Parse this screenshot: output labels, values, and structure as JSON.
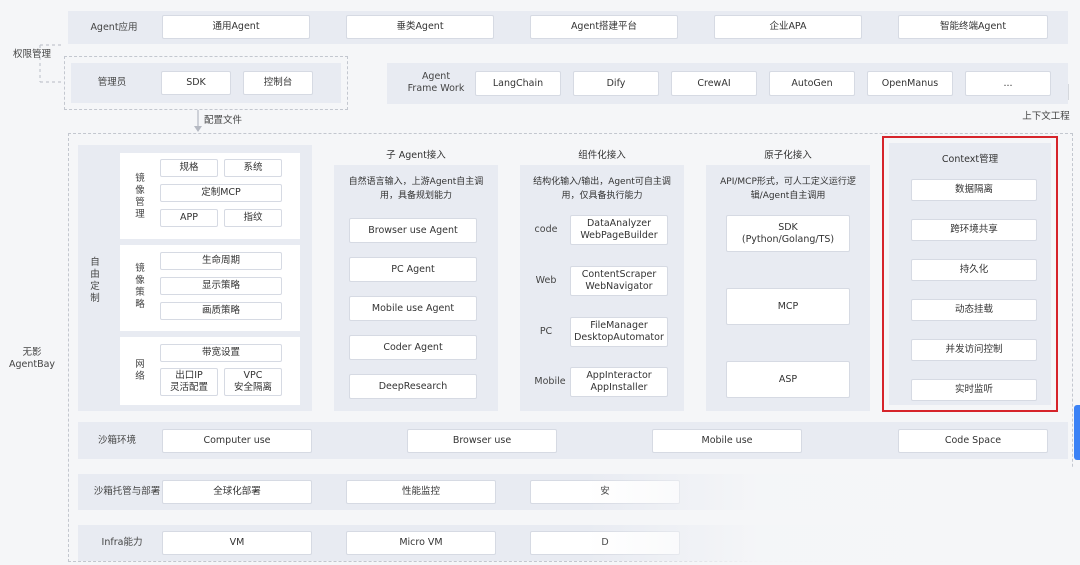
{
  "side_labels": {
    "permission": "权限管理",
    "agentbay_line1": "无影",
    "agentbay_line2": "AgentBay",
    "context_eng": "上下文工程"
  },
  "top_row": {
    "label": "Agent应用",
    "items": [
      "通用Agent",
      "垂类Agent",
      "Agent搭建平台",
      "企业APA",
      "智能终端Agent"
    ]
  },
  "admin": {
    "label": "管理员",
    "items": [
      "SDK",
      "控制台"
    ],
    "config_label": "配置文件"
  },
  "framework": {
    "label": "Agent\nFrame Work",
    "items": [
      "LangChain",
      "Dify",
      "CrewAI",
      "AutoGen",
      "OpenManus",
      "..."
    ]
  },
  "customize": {
    "label": "自由定制",
    "image_mgmt": {
      "label": "镜像管理",
      "items": [
        "规格",
        "系统",
        "定制MCP",
        "APP",
        "指纹"
      ]
    },
    "image_policy": {
      "label": "镜像策略",
      "items": [
        "生命周期",
        "显示策略",
        "画质策略"
      ]
    },
    "network": {
      "label": "网络",
      "items": [
        "带宽设置",
        "出口IP\n灵活配置",
        "VPC\n安全隔离"
      ]
    }
  },
  "sub_agent": {
    "title": "子 Agent接入",
    "desc": "自然语言输入，上游Agent自主调用，具备规划能力",
    "items": [
      "Browser use Agent",
      "PC Agent",
      "Mobile use Agent",
      "Coder Agent",
      "DeepResearch"
    ]
  },
  "component": {
    "title": "组件化接入",
    "desc": "结构化输入/输出，Agent可自主调用，仅具备执行能力",
    "rows": [
      {
        "label": "code",
        "value": "DataAnalyzer\nWebPageBuilder"
      },
      {
        "label": "Web",
        "value": "ContentScraper\nWebNavigator"
      },
      {
        "label": "PC",
        "value": "FileManager\nDesktopAutomator"
      },
      {
        "label": "Mobile",
        "value": "AppInteractor\nAppInstaller"
      }
    ]
  },
  "atomic": {
    "title": "原子化接入",
    "desc": "API/MCP形式，可人工定义运行逻辑/Agent自主调用",
    "items": [
      "SDK\n(Python/Golang/TS)",
      "MCP",
      "ASP"
    ]
  },
  "context": {
    "title": "Context管理",
    "items": [
      "数据隔离",
      "跨环境共享",
      "持久化",
      "动态挂载",
      "并发访问控制",
      "实时监听"
    ]
  },
  "sandbox": {
    "label": "沙箱环境",
    "items": [
      "Computer use",
      "Browser use",
      "Mobile use",
      "Code Space"
    ]
  },
  "hosting": {
    "label": "沙箱托管与部署",
    "items": [
      "全球化部署",
      "性能监控",
      "安"
    ]
  },
  "infra": {
    "label": "Infra能力",
    "items": [
      "VM",
      "Micro VM",
      "D"
    ]
  }
}
